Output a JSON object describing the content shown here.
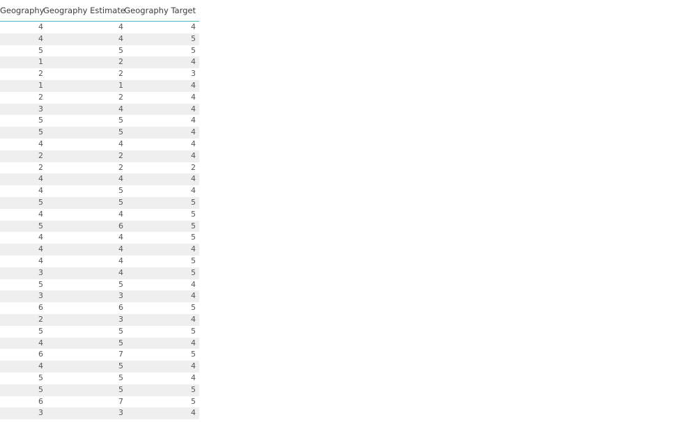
{
  "table": {
    "columns": [
      "Geography",
      "Geography Estimate",
      "Geography Target"
    ],
    "rows": [
      [
        4,
        4,
        4
      ],
      [
        4,
        4,
        5
      ],
      [
        5,
        5,
        5
      ],
      [
        1,
        2,
        4
      ],
      [
        2,
        2,
        3
      ],
      [
        1,
        1,
        4
      ],
      [
        2,
        2,
        4
      ],
      [
        3,
        4,
        4
      ],
      [
        5,
        5,
        4
      ],
      [
        5,
        5,
        4
      ],
      [
        4,
        4,
        4
      ],
      [
        2,
        2,
        4
      ],
      [
        2,
        2,
        2
      ],
      [
        4,
        4,
        4
      ],
      [
        4,
        5,
        4
      ],
      [
        5,
        5,
        5
      ],
      [
        4,
        4,
        5
      ],
      [
        5,
        6,
        5
      ],
      [
        4,
        4,
        5
      ],
      [
        4,
        4,
        4
      ],
      [
        4,
        4,
        5
      ],
      [
        3,
        4,
        5
      ],
      [
        5,
        5,
        4
      ],
      [
        3,
        3,
        4
      ],
      [
        6,
        6,
        5
      ],
      [
        2,
        3,
        4
      ],
      [
        5,
        5,
        5
      ],
      [
        4,
        5,
        4
      ],
      [
        6,
        7,
        5
      ],
      [
        4,
        5,
        4
      ],
      [
        5,
        5,
        4
      ],
      [
        5,
        5,
        5
      ],
      [
        6,
        7,
        5
      ],
      [
        3,
        3,
        4
      ]
    ]
  },
  "colors": {
    "header_rule": "#4bb8c9",
    "stripe": "#efefef"
  }
}
